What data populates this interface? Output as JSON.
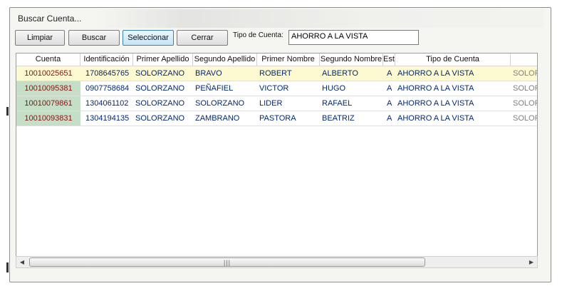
{
  "window": {
    "title": "Buscar Cuenta..."
  },
  "toolbar": {
    "limpiar": "Limpiar",
    "buscar": "Buscar",
    "seleccionar": "Seleccionar",
    "cerrar": "Cerrar",
    "tipo_label": "Tipo de Cuenta:",
    "tipo_value": "AHORRO A LA VISTA"
  },
  "table": {
    "headers": [
      "Cuenta",
      "Identificación",
      "Primer Apellido",
      "Segundo Apellido",
      "Primer Nombre",
      "Segundo Nombre",
      "Est.",
      "Tipo de Cuenta",
      ""
    ],
    "rows": [
      [
        "10010025651",
        "1708645765",
        "SOLORZANO",
        "BRAVO",
        "ROBERT",
        "ALBERTO",
        "A",
        "AHORRO A LA VISTA",
        "SOLOR"
      ],
      [
        "10010095381",
        "0907758684",
        "SOLORZANO",
        "PEÑAFIEL",
        "VICTOR",
        "HUGO",
        "A",
        "AHORRO A LA VISTA",
        "SOLOR"
      ],
      [
        "10010079861",
        "1304061102",
        "SOLORZANO",
        "SOLORZANO",
        "LIDER",
        "RAFAEL",
        "A",
        "AHORRO A LA VISTA",
        "SOLOR"
      ],
      [
        "10010093831",
        "1304194135",
        "SOLORZANO",
        "ZAMBRANO",
        "PASTORA",
        "BEATRIZ",
        "A",
        "AHORRO A LA VISTA",
        "SOLOR"
      ]
    ]
  },
  "colors": {
    "cuenta_bg": "#c5dec6",
    "cuenta_text": "#8a1212",
    "selected_row": "#fdf9d0",
    "data_text": "#00287a"
  },
  "icons": {
    "scroll_left": "triangle-left",
    "scroll_right": "triangle-right"
  }
}
